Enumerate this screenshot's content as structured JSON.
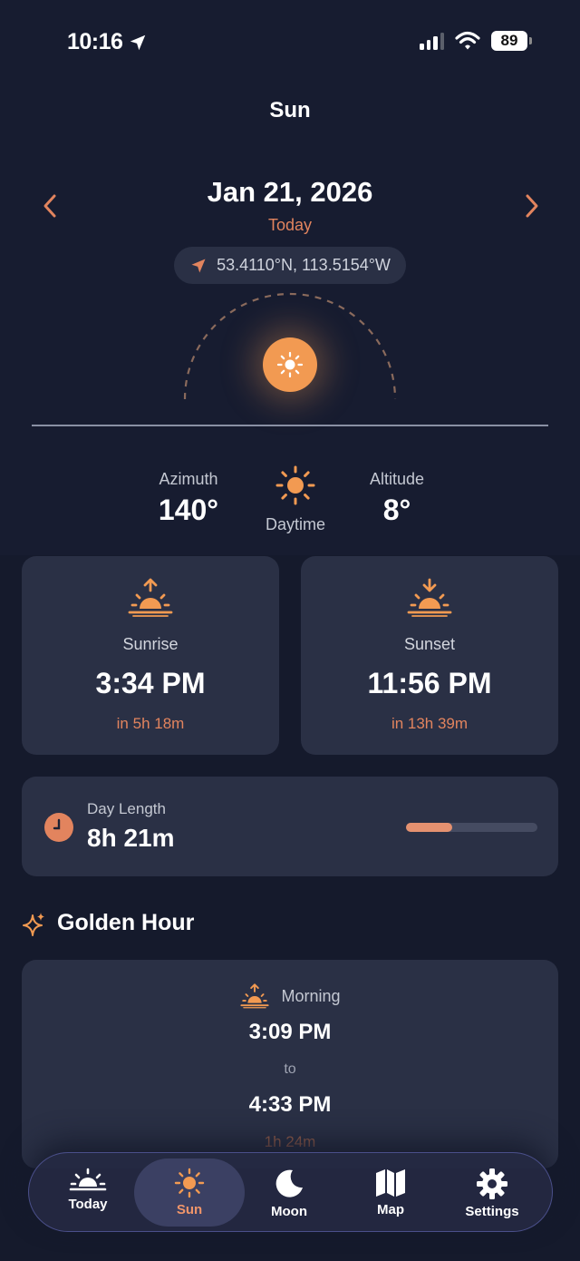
{
  "status_bar": {
    "time": "10:16",
    "battery": "89"
  },
  "header": {
    "title": "Sun"
  },
  "date_nav": {
    "date": "Jan 21, 2026",
    "relative": "Today",
    "coordinates": "53.4110°N, 113.5154°W"
  },
  "position": {
    "azimuth_label": "Azimuth",
    "azimuth_value": "140°",
    "phase_label": "Daytime",
    "altitude_label": "Altitude",
    "altitude_value": "8°"
  },
  "sunrise": {
    "label": "Sunrise",
    "time": "3:34 PM",
    "until": "in 5h 18m"
  },
  "sunset": {
    "label": "Sunset",
    "time": "11:56 PM",
    "until": "in 13h 39m"
  },
  "day_length": {
    "label": "Day Length",
    "value": "8h 21m",
    "progress": 0.35
  },
  "golden_hour": {
    "title": "Golden Hour",
    "morning_label": "Morning",
    "start": "3:09 PM",
    "to": "to",
    "end": "4:33 PM",
    "duration": "1h 24m"
  },
  "tabs": [
    {
      "label": "Today",
      "icon": "sunrise-icon",
      "active": false
    },
    {
      "label": "Sun",
      "icon": "sun-icon",
      "active": true
    },
    {
      "label": "Moon",
      "icon": "moon-icon",
      "active": false
    },
    {
      "label": "Map",
      "icon": "map-icon",
      "active": false
    },
    {
      "label": "Settings",
      "icon": "gear-icon",
      "active": false
    }
  ],
  "colors": {
    "accent": "#e2845e",
    "sun": "#f29a52",
    "background": "#151a2c",
    "card": "#2a3045"
  }
}
